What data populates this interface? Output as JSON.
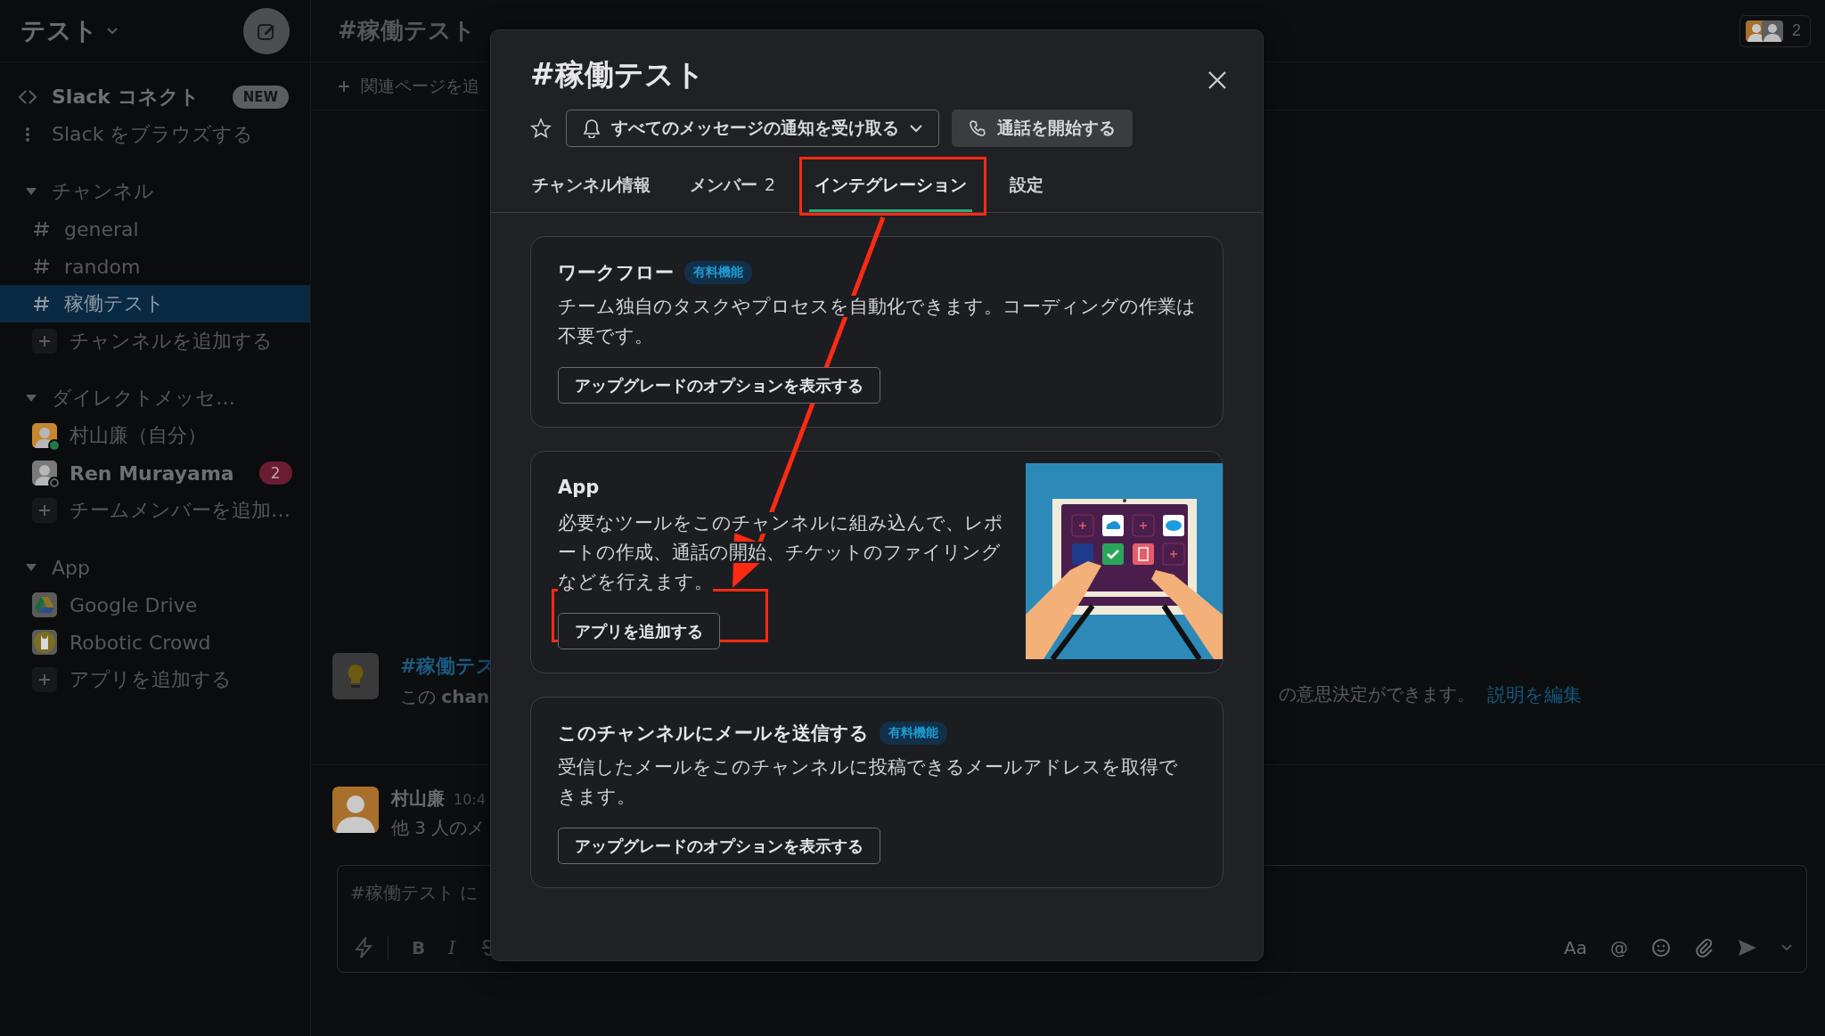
{
  "workspace": {
    "name": "テスト"
  },
  "sidebar": {
    "top_items": [
      {
        "kind": "connect",
        "label": "Slack コネクト",
        "badge": "NEW"
      },
      {
        "kind": "browse",
        "label": "Slack をブラウズする"
      }
    ],
    "sections": [
      {
        "title": "チャンネル",
        "expanded": true,
        "items": [
          {
            "kind": "channel",
            "label": "general",
            "selected": false
          },
          {
            "kind": "channel",
            "label": "random",
            "selected": false
          },
          {
            "kind": "channel",
            "label": "稼働テスト",
            "selected": true
          },
          {
            "kind": "add",
            "label": "チャンネルを追加する",
            "selected": false
          }
        ]
      },
      {
        "title": "ダイレクトメッセ…",
        "expanded": true,
        "items": [
          {
            "kind": "person",
            "label": "村山廉（自分）",
            "selected": false,
            "online": true,
            "unread": false,
            "color": "#c8862e"
          },
          {
            "kind": "person",
            "label": "Ren Murayama",
            "selected": false,
            "online": false,
            "unread": true,
            "color": "#7a7a7a",
            "badge": "2"
          },
          {
            "kind": "add",
            "label": "チームメンバーを追加…",
            "selected": false
          }
        ]
      },
      {
        "title": "App",
        "expanded": true,
        "items": [
          {
            "kind": "driveapp",
            "label": "Google Drive",
            "selected": false
          },
          {
            "kind": "crowdapp",
            "label": "Robotic Crowd",
            "selected": false
          },
          {
            "kind": "add",
            "label": "アプリを追加する",
            "selected": false
          }
        ]
      }
    ]
  },
  "channel_header": {
    "title": "#稼働テスト",
    "member_count": "2",
    "bookmark": "関連ページを追"
  },
  "intro": {
    "link": "#稼働テス",
    "text_left": "この **chan**",
    "text_right": "の意思決定ができます。",
    "edit_link": "説明を編集"
  },
  "message": {
    "author": "村山廉",
    "time": "10:4",
    "text": "他 3 人のメ"
  },
  "composer": {
    "placeholder": "#稼働テスト に",
    "glyphs_left": [
      "B",
      "I"
    ],
    "glyphs_right": [
      "Aa",
      "@"
    ]
  },
  "modal": {
    "title": "#稼働テスト",
    "starred": false,
    "notify_button": "すべてのメッセージの通知を受け取る",
    "call_button": "通話を開始する",
    "tabs": [
      {
        "label": "チャンネル情報",
        "selected": false
      },
      {
        "label": "メンバー",
        "count": "2",
        "selected": false
      },
      {
        "label": "インテグレーション",
        "selected": true
      },
      {
        "label": "設定",
        "selected": false
      }
    ],
    "cards": [
      {
        "kind": "feature",
        "title": "ワークフロー",
        "badge": "有料機能",
        "description": "チーム独自のタスクやプロセスを自動化できます。コーディングの作業は不要です。",
        "button": "アップグレードのオプションを表示する"
      },
      {
        "kind": "app",
        "title": "App",
        "description": "必要なツールをこのチャンネルに組み込んで、レポートの作成、通話の開始、チケットのファイリングなどを行えます。",
        "button": "アプリを追加する"
      },
      {
        "kind": "feature",
        "title": "このチャンネルにメールを送信する",
        "badge": "有料機能",
        "description": "受信したメールをこのチャンネルに投稿できるメールアドレスを取得できます。",
        "button": "アップグレードのオプションを表示する"
      }
    ]
  }
}
